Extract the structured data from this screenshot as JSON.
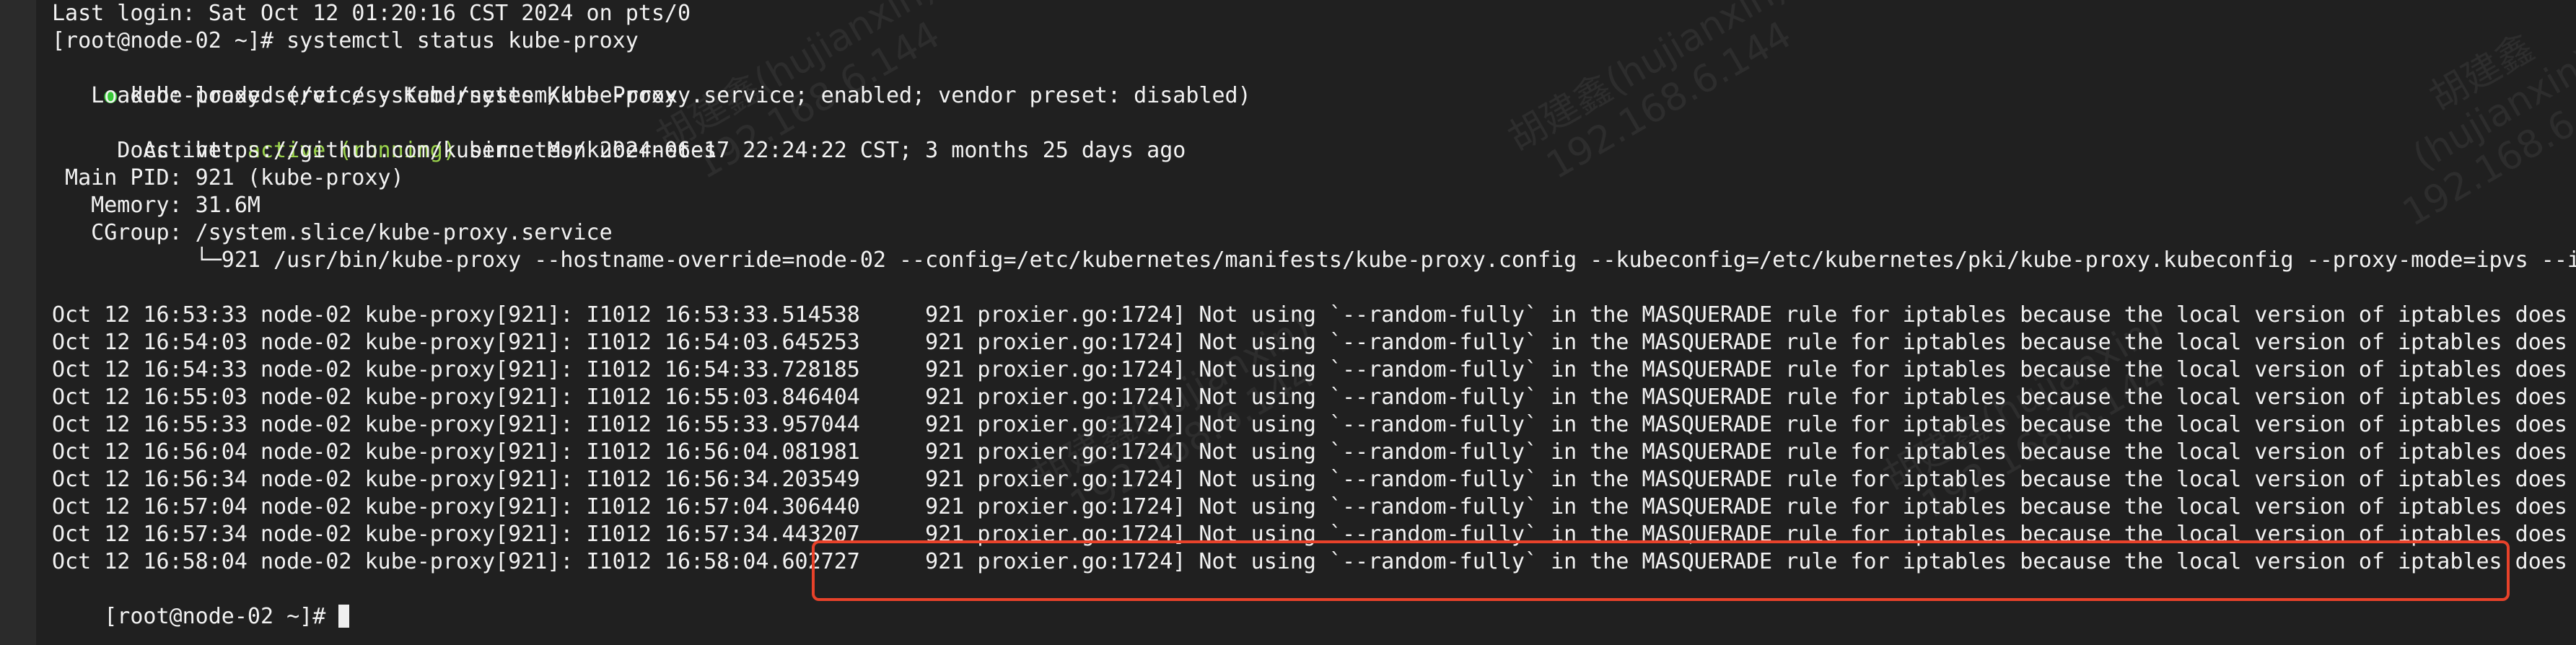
{
  "terminal": {
    "lines": {
      "l0": "Last login: Sat Oct 12 01:20:16 CST 2024 on pts/0",
      "l1": "[root@node-02 ~]# systemctl status kube-proxy",
      "l2_bullet": "●",
      "l2_text": " kube-proxy.service - Kubernetes Kube-Proxy",
      "l3": "   Loaded: loaded (/etc/systemd/system/kube-proxy.service; enabled; vendor preset: disabled)",
      "l4_prefix": "   Active: ",
      "l4_status": "active (running)",
      "l4_suffix": " since Mon 2024-06-17 22:24:22 CST; 3 months 25 days ago",
      "l5": "     Docs: https://github.com/kubernetes/kubernetes",
      "l6": " Main PID: 921 (kube-proxy)",
      "l7": "   Memory: 31.6M",
      "l8": "   CGroup: /system.slice/kube-proxy.service",
      "l9": "           └─921 /usr/bin/kube-proxy --hostname-override=node-02 --config=/etc/kubernetes/manifests/kube-proxy.config --kubeconfig=/etc/kubernetes/pki/kube-proxy.kubeconfig --proxy-mode=ipvs --ipvs-scheduler=rr --masquerade-all=true",
      "l11": "Oct 12 16:53:33 node-02 kube-proxy[921]: I1012 16:53:33.514538     921 proxier.go:1724] Not using `--random-fully` in the MASQUERADE rule for iptables because the local version of iptables does not support it",
      "l12": "Oct 12 16:54:03 node-02 kube-proxy[921]: I1012 16:54:03.645253     921 proxier.go:1724] Not using `--random-fully` in the MASQUERADE rule for iptables because the local version of iptables does not support it",
      "l13": "Oct 12 16:54:33 node-02 kube-proxy[921]: I1012 16:54:33.728185     921 proxier.go:1724] Not using `--random-fully` in the MASQUERADE rule for iptables because the local version of iptables does not support it",
      "l14": "Oct 12 16:55:03 node-02 kube-proxy[921]: I1012 16:55:03.846404     921 proxier.go:1724] Not using `--random-fully` in the MASQUERADE rule for iptables because the local version of iptables does not support it",
      "l15": "Oct 12 16:55:33 node-02 kube-proxy[921]: I1012 16:55:33.957044     921 proxier.go:1724] Not using `--random-fully` in the MASQUERADE rule for iptables because the local version of iptables does not support it",
      "l16": "Oct 12 16:56:04 node-02 kube-proxy[921]: I1012 16:56:04.081981     921 proxier.go:1724] Not using `--random-fully` in the MASQUERADE rule for iptables because the local version of iptables does not support it",
      "l17": "Oct 12 16:56:34 node-02 kube-proxy[921]: I1012 16:56:34.203549     921 proxier.go:1724] Not using `--random-fully` in the MASQUERADE rule for iptables because the local version of iptables does not support it",
      "l18": "Oct 12 16:57:04 node-02 kube-proxy[921]: I1012 16:57:04.306440     921 proxier.go:1724] Not using `--random-fully` in the MASQUERADE rule for iptables because the local version of iptables does not support it",
      "l19": "Oct 12 16:57:34 node-02 kube-proxy[921]: I1012 16:57:34.443207     921 proxier.go:1724] Not using `--random-fully` in the MASQUERADE rule for iptables because the local version of iptables does not support it",
      "l20": "Oct 12 16:58:04 node-02 kube-proxy[921]: I1012 16:58:04.602727     921 proxier.go:1724] Not using `--random-fully` in the MASQUERADE rule for iptables because the local version of iptables does not support it",
      "l21": "[root@node-02 ~]# "
    }
  },
  "watermark": {
    "name": "胡建鑫(hujianxin)",
    "ip": "192.168.6.144"
  },
  "colors": {
    "background": "#202020",
    "text": "#f2f2f2",
    "active": "#9ad34b",
    "highlight": "#e8422a"
  }
}
